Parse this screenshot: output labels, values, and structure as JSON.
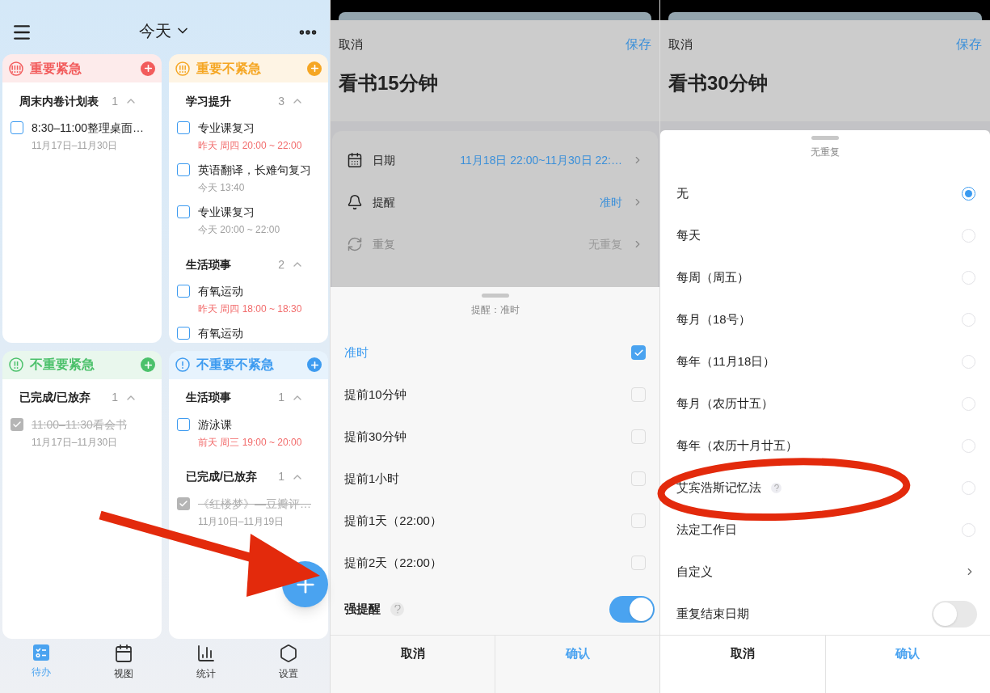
{
  "todo_screen": {
    "title": "今天",
    "quadrants": [
      {
        "title": "重要紧急",
        "color": "#f25c5c",
        "groups": [
          {
            "name": "周末内卷计划表",
            "count": "1",
            "expanded": true,
            "tasks": [
              {
                "title": "8:30–11:00整理桌面…",
                "time": "11月17日–11月30日",
                "overdue": false,
                "checked": false
              }
            ]
          }
        ]
      },
      {
        "title": "重要不紧急",
        "color": "#f5a623",
        "groups": [
          {
            "name": "学习提升",
            "count": "3",
            "expanded": true,
            "tasks": [
              {
                "title": "专业课复习",
                "time": "昨天 周四 20:00 ~ 22:00",
                "overdue": true,
                "checked": false
              },
              {
                "title": "英语翻译，长难句复习",
                "time": "今天  13:40",
                "overdue": false,
                "checked": false
              },
              {
                "title": "专业课复习",
                "time": "今天  20:00 ~ 22:00",
                "overdue": false,
                "checked": false
              }
            ]
          },
          {
            "name": "生活琐事",
            "count": "2",
            "expanded": true,
            "tasks": [
              {
                "title": "有氧运动",
                "time": "昨天 周四 18:00 ~ 18:30",
                "overdue": true,
                "checked": false
              },
              {
                "title": "有氧运动",
                "checked": false
              }
            ]
          }
        ]
      },
      {
        "title": "不重要紧急",
        "color": "#4cc16b",
        "groups": [
          {
            "name": "已完成/已放弃",
            "count": "1",
            "expanded": true,
            "tasks": [
              {
                "title": "11:00–11:30看会书",
                "time": "11月17日–11月30日",
                "overdue": false,
                "checked": true
              }
            ]
          }
        ]
      },
      {
        "title": "不重要不紧急",
        "color": "#3d9bf0",
        "groups": [
          {
            "name": "生活琐事",
            "count": "1",
            "expanded": true,
            "tasks": [
              {
                "title": "游泳课",
                "time": "前天 周三 19:00 ~ 20:00",
                "overdue": true,
                "checked": false
              }
            ]
          },
          {
            "name": "已完成/已放弃",
            "count": "1",
            "expanded": true,
            "tasks": [
              {
                "title": "《红楼梦》—豆瓣评…",
                "time": "11月10日–11月19日",
                "overdue": false,
                "checked": true
              }
            ]
          }
        ]
      }
    ],
    "nav": [
      {
        "kind": "todo",
        "label": "待办",
        "selected": true
      },
      {
        "kind": "view",
        "label": "视图",
        "selected": false
      },
      {
        "kind": "stats",
        "label": "统计",
        "selected": false
      },
      {
        "kind": "settings",
        "label": "设置",
        "selected": false
      }
    ]
  },
  "reminder_screen": {
    "cancel": "取消",
    "save": "保存",
    "task_title": "看书15分钟",
    "fields": [
      {
        "kind": "date",
        "label": "日期",
        "value": "11月18日 22:00~11月30日 22:…",
        "enabled": true
      },
      {
        "kind": "reminder",
        "label": "提醒",
        "value": "准时",
        "enabled": true
      },
      {
        "kind": "repeat",
        "label": "重复",
        "value": "无重复",
        "enabled": false
      }
    ],
    "sheet": {
      "title": "提醒：准时",
      "options": [
        {
          "label": "准时",
          "selected": true
        },
        {
          "label": "提前10分钟",
          "selected": false
        },
        {
          "label": "提前30分钟",
          "selected": false
        },
        {
          "label": "提前1小时",
          "selected": false
        },
        {
          "label": "提前1天（22:00）",
          "selected": false
        },
        {
          "label": "提前2天（22:00）",
          "selected": false
        }
      ],
      "strong_reminder": {
        "label": "强提醒",
        "on": true
      },
      "cancel": "取消",
      "confirm": "确认"
    }
  },
  "repeat_screen": {
    "cancel": "取消",
    "save": "保存",
    "task_title": "看书30分钟",
    "sheet": {
      "title": "无重复",
      "options": [
        {
          "kind": "radio",
          "label": "无",
          "selected": true
        },
        {
          "kind": "radio",
          "label": "每天",
          "selected": false
        },
        {
          "kind": "radio",
          "label": "每周（周五）",
          "selected": false
        },
        {
          "kind": "radio",
          "label": "每月（18号）",
          "selected": false
        },
        {
          "kind": "radio",
          "label": "每年（11月18日）",
          "selected": false
        },
        {
          "kind": "radio",
          "label": "每月（农历廿五）",
          "selected": false
        },
        {
          "kind": "radio",
          "label": "每年（农历十月廿五）",
          "selected": false
        },
        {
          "kind": "radio_help",
          "label": "艾宾浩斯记忆法",
          "selected": false
        },
        {
          "kind": "radio",
          "label": "法定工作日",
          "selected": false
        },
        {
          "kind": "link",
          "label": "自定义"
        }
      ],
      "end_date": {
        "label": "重复结束日期",
        "on": false
      },
      "cancel": "取消",
      "confirm": "确认"
    }
  }
}
